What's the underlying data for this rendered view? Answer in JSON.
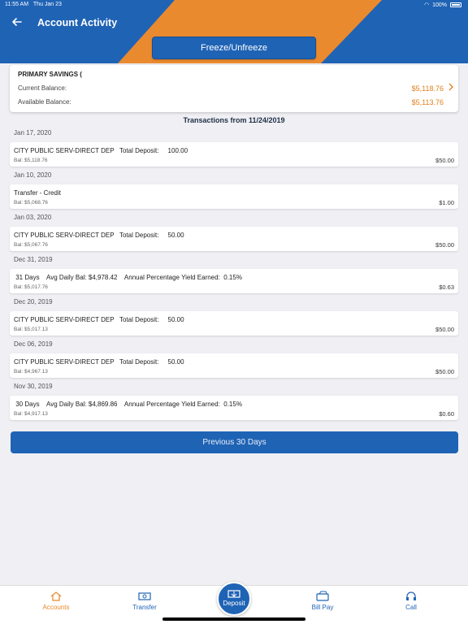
{
  "status": {
    "time": "11:55 AM",
    "date": "Thu Jan 23",
    "battery": "100%"
  },
  "header": {
    "title": "Account Activity",
    "freeze_label": "Freeze/Unfreeze"
  },
  "account": {
    "name": "PRIMARY SAVINGS (",
    "current_label": "Current Balance:",
    "current_value": "$5,118.76",
    "available_label": "Available Balance:",
    "available_value": "$5,113.76"
  },
  "transactions_heading": "Transactions from 11/24/2019",
  "transactions": [
    {
      "date": "Jan 17, 2020",
      "desc": "CITY PUBLIC SERV-DIRECT DEP   Total Deposit:     100.00",
      "bal": "Bal: $5,118.76",
      "amount": "$50.00"
    },
    {
      "date": "Jan 10, 2020",
      "desc": "Transfer - Credit",
      "bal": "Bal: $5,068.76",
      "amount": "$1.00"
    },
    {
      "date": "Jan 03, 2020",
      "desc": "CITY PUBLIC SERV-DIRECT DEP   Total Deposit:     50.00",
      "bal": "Bal: $5,067.76",
      "amount": "$50.00"
    },
    {
      "date": "Dec 31, 2019",
      "desc": " 31 Days    Avg Daily Bal: $4,978.42    Annual Percentage Yield Earned:  0.15%",
      "bal": "Bal: $5,017.76",
      "amount": "$0.63"
    },
    {
      "date": "Dec 20, 2019",
      "desc": "CITY PUBLIC SERV-DIRECT DEP   Total Deposit:     50.00",
      "bal": "Bal: $5,017.13",
      "amount": "$50.00"
    },
    {
      "date": "Dec 06, 2019",
      "desc": "CITY PUBLIC SERV-DIRECT DEP   Total Deposit:     50.00",
      "bal": "Bal: $4,967.13",
      "amount": "$50.00"
    },
    {
      "date": "Nov 30, 2019",
      "desc": " 30 Days    Avg Daily Bal: $4,869.86    Annual Percentage Yield Earned:  0.15%",
      "bal": "Bal: $4,917.13",
      "amount": "$0.60"
    }
  ],
  "prev_button": "Previous 30 Days",
  "tabs": {
    "accounts": "Accounts",
    "transfer": "Transfer",
    "deposit": "Deposit",
    "billpay": "Bill Pay",
    "call": "Call"
  },
  "colors": {
    "brand_blue": "#1f63b5",
    "accent_orange": "#e8892a"
  }
}
